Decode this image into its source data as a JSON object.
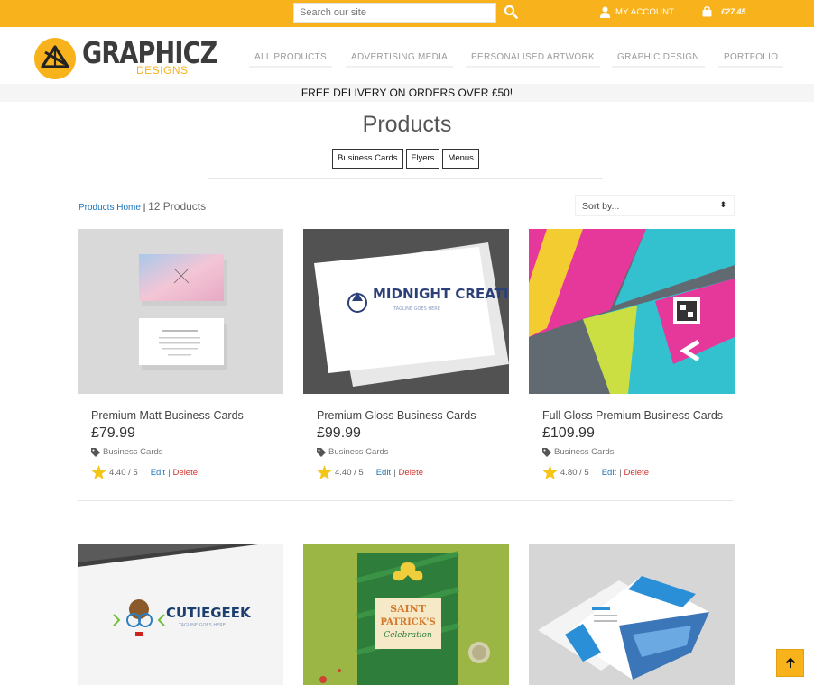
{
  "topbar": {
    "search_placeholder": "Search our site",
    "account_label": "MY ACCOUNT",
    "cart_total": "£27.45",
    "icons": [
      "search-icon",
      "user-icon",
      "bag-icon"
    ]
  },
  "brand": {
    "name": "GRAPHICZ",
    "sub": "DESIGNS",
    "accent": "#f7b21c"
  },
  "nav": [
    "ALL PRODUCTS",
    "ADVERTISING MEDIA",
    "PERSONALISED ARTWORK",
    "GRAPHIC DESIGN",
    "PORTFOLIO"
  ],
  "promo": "FREE DELIVERY ON ORDERS OVER £50!",
  "page_title": "Products",
  "filters": [
    "Business Cards",
    "Flyers",
    "Menus"
  ],
  "breadcrumb": {
    "home": "Products Home",
    "separator": "|",
    "count": "12 Products"
  },
  "sort_label": "Sort by...",
  "products": [
    {
      "name": "Premium Matt Business Cards",
      "price": "£79.99",
      "category": "Business Cards",
      "rating": "4.40 / 5",
      "edit": "Edit",
      "sep": "|",
      "delete": "Delete"
    },
    {
      "name": "Premium Gloss Business Cards",
      "price": "£99.99",
      "category": "Business Cards",
      "rating": "4.40 / 5",
      "edit": "Edit",
      "sep": "|",
      "delete": "Delete"
    },
    {
      "name": "Full Gloss Premium Business Cards",
      "price": "£109.99",
      "category": "Business Cards",
      "rating": "4.80 / 5",
      "edit": "Edit",
      "sep": "|",
      "delete": "Delete"
    }
  ],
  "image_text": {
    "midnight": "MIDNIGHT CREATIVE",
    "midnight_tag": "TAGLINE GOES HERE",
    "cutie": "CUTIEGEEK",
    "cutie_tag": "TAGLINE GOES HERE",
    "patrick_1": "SAINT",
    "patrick_2": "PATRICK'S",
    "patrick_3": "Celebration"
  }
}
